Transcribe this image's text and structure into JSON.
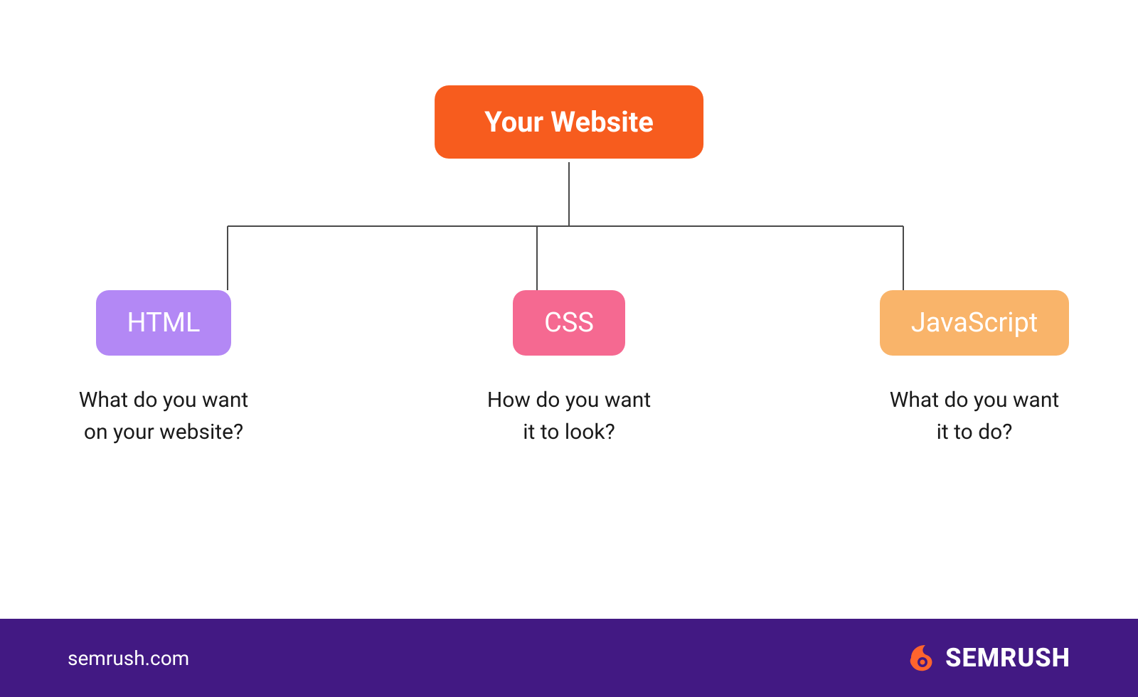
{
  "diagram": {
    "root": {
      "label": "Your Website",
      "color": "#f75c1e"
    },
    "children": [
      {
        "label": "HTML",
        "color": "#b388f5",
        "caption_line1": "What do you want",
        "caption_line2": "on your website?"
      },
      {
        "label": "CSS",
        "color": "#f56991",
        "caption_line1": "How do you want",
        "caption_line2": "it to look?"
      },
      {
        "label": "JavaScript",
        "color": "#f9b46a",
        "caption_line1": "What do you want",
        "caption_line2": "it to do?"
      }
    ]
  },
  "footer": {
    "url": "semrush.com",
    "brand": "SEMRUSH",
    "bg_color": "#421983",
    "accent_color": "#ff642d"
  }
}
